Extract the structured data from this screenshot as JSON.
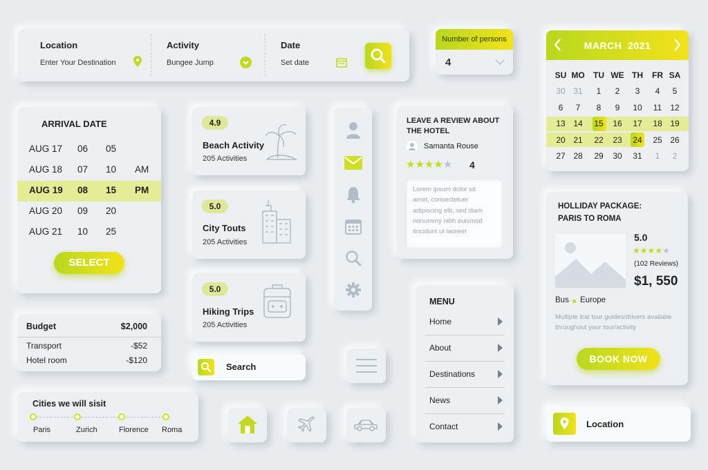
{
  "search_bar": {
    "location_label": "Location",
    "location_value": "Enter Your Destination",
    "activity_label": "Activity",
    "activity_value": "Bungee Jump",
    "date_label": "Date",
    "date_value": "Set date"
  },
  "persons": {
    "label": "Number of persons",
    "value": "4"
  },
  "calendar": {
    "month": "MARCH",
    "year": "2021",
    "weekdays": [
      "SU",
      "MO",
      "TU",
      "WE",
      "TH",
      "FR",
      "SA"
    ],
    "weeks": [
      [
        "30",
        "31",
        "1",
        "2",
        "3",
        "4",
        "5"
      ],
      [
        "6",
        "7",
        "8",
        "9",
        "10",
        "11",
        "12"
      ],
      [
        "13",
        "14",
        "15",
        "16",
        "17",
        "18",
        "19"
      ],
      [
        "20",
        "21",
        "22",
        "23",
        "24",
        "25",
        "26"
      ],
      [
        "27",
        "28",
        "29",
        "30",
        "31",
        "1",
        "2"
      ]
    ],
    "selected_start": "15",
    "selected_end": "24"
  },
  "arrival": {
    "title": "ARRIVAL DATE",
    "rows": [
      {
        "day": "AUG 17",
        "hour": "06",
        "minute": "05",
        "period": ""
      },
      {
        "day": "AUG 18",
        "hour": "07",
        "minute": "10",
        "period": "AM"
      },
      {
        "day": "AUG 19",
        "hour": "08",
        "minute": "15",
        "period": "PM"
      },
      {
        "day": "AUG 20",
        "hour": "09",
        "minute": "20",
        "period": ""
      },
      {
        "day": "AUG 21",
        "hour": "10",
        "minute": "25",
        "period": ""
      }
    ],
    "button": "SELECT"
  },
  "activities": [
    {
      "rating": "4.9",
      "name": "Beach Activity",
      "count": "205 Activities",
      "icon": "palm-tree-icon"
    },
    {
      "rating": "5.0",
      "name": "City Touts",
      "count": "205 Activities",
      "icon": "buildings-icon"
    },
    {
      "rating": "5.0",
      "name": "Hiking Trips",
      "count": "205 Activities",
      "icon": "backpack-icon"
    }
  ],
  "review": {
    "title_line1": "LEAVE A REVIEW ABOUT",
    "title_line2": "THE HOTEL",
    "user": "Samanta Rouse",
    "rating": "4",
    "stars_filled": 4,
    "text_lines": [
      "Lorem ipsum dolor sit",
      "amet, consectetuer",
      "adipiscing elit, sed diam",
      "nonummy nibh euismod",
      "tincidunt ut laoreet"
    ]
  },
  "package": {
    "title_line1": "HOLLIDAY PACKAGE:",
    "title_line2": "PARIS TO ROMA",
    "rating": "5.0",
    "reviews": "(102 Reviews)",
    "price": "$1, 550",
    "transport": "Bus",
    "region": "Europe",
    "desc_line1": "Multiple lcal tour guides/drivers availabe",
    "desc_line2": "throughout your tour/activity",
    "button": "BOOK NOW"
  },
  "budget": {
    "title": "Budget",
    "total": "$2,000",
    "items": [
      {
        "name": "Transport",
        "amount": "-$52"
      },
      {
        "name": "Hotel room",
        "amount": "-$120"
      }
    ]
  },
  "cities": {
    "title": "Cities we will sisit",
    "list": [
      "Paris",
      "Zurich",
      "Florence",
      "Roma"
    ]
  },
  "search": {
    "label": "Search"
  },
  "menu": {
    "title": "MENU",
    "items": [
      "Home",
      "About",
      "Destinations",
      "News",
      "Contact"
    ]
  },
  "location_button": {
    "label": "Location"
  },
  "colors": {
    "accent_green": "#b9d81e",
    "accent_yellow": "#f2e21a",
    "highlight_row": "#e4ec96"
  }
}
